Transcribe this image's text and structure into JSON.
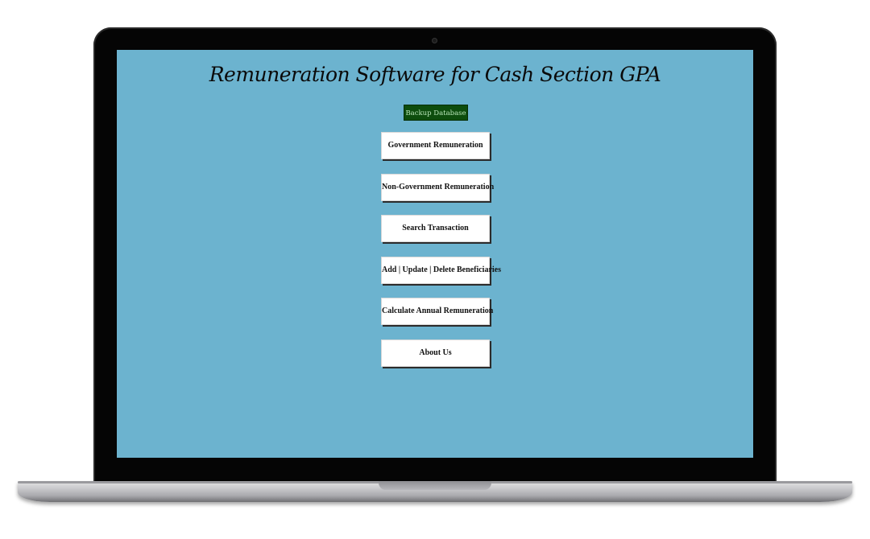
{
  "app": {
    "title": "Remuneration Software for Cash Section GPA"
  },
  "toolbar": {
    "backup_label": "Backup Database"
  },
  "menu": {
    "items": [
      {
        "label": "Government Remuneration"
      },
      {
        "label": "Non-Government Remuneration"
      },
      {
        "label": "Search Transaction"
      },
      {
        "label": "Add | Update | Delete Beneficiaries"
      },
      {
        "label": "Calculate Annual Remuneration"
      },
      {
        "label": "About Us"
      }
    ]
  },
  "colors": {
    "screen_background": "#6cb3cf",
    "backup_button": "#0d4d0d",
    "menu_button": "#ffffff"
  }
}
